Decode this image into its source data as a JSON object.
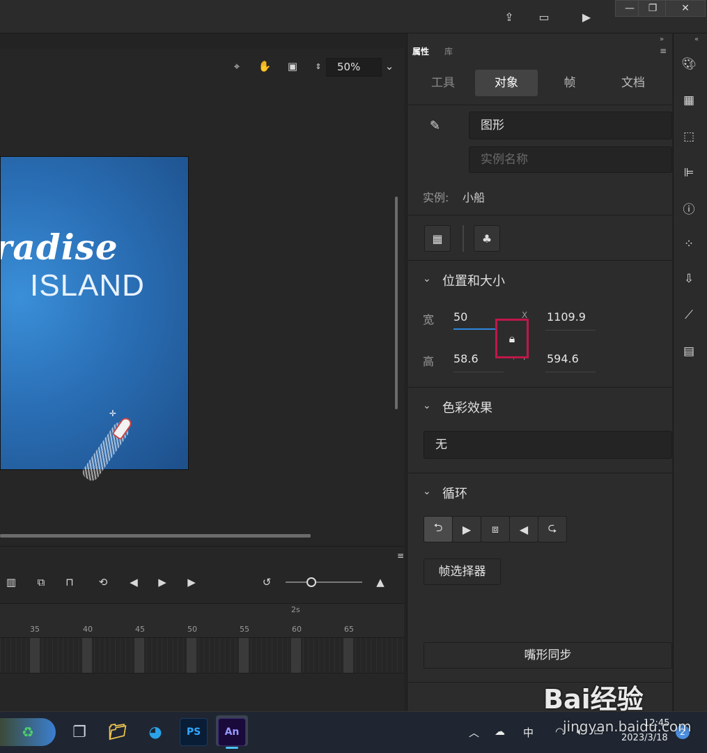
{
  "stage": {
    "zoom_value": "50%",
    "artboard_title": "radise",
    "artboard_subtitle": "ISLAND"
  },
  "timeline": {
    "time_label": "2s",
    "frame_ticks": [
      "35",
      "40",
      "45",
      "50",
      "55",
      "60",
      "65"
    ]
  },
  "panel": {
    "tab_properties": "属性",
    "tab_library": "库",
    "subtabs": [
      "工具",
      "对象",
      "帧",
      "文档"
    ],
    "active_subtab": "对象",
    "symbol_type": "图形",
    "instance_name_placeholder": "实例名称",
    "instance_label": "实例:",
    "instance_value": "小船",
    "section_position": "位置和大小",
    "width_label": "宽",
    "width_value": "50",
    "height_label": "高",
    "height_value": "58.6",
    "x_label": "X",
    "x_value": "1109.9",
    "y_label": "Y",
    "y_value": "594.6",
    "section_color": "色彩效果",
    "color_effect_value": "无",
    "section_loop": "循环",
    "frame_picker_label": "帧选择器",
    "lip_sync_label": "嘴形同步"
  },
  "taskbar": {
    "apps": [
      "PS",
      "An"
    ],
    "tray_time": "12:45",
    "tray_date": "2023/3/18",
    "tray_ime": "中",
    "notification_count": "2"
  },
  "watermark": {
    "text": "Bai经验",
    "sub": "jingyan.baidu.com"
  },
  "colors": {
    "accent_blue": "#2e86de",
    "highlight_red": "#c0174a",
    "panel_bg": "#2c2c2c"
  }
}
